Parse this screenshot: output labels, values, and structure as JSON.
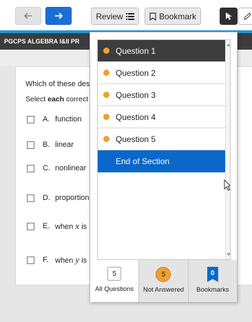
{
  "toolbar": {
    "back_icon": "arrow-left-icon",
    "next_icon": "arrow-right-icon",
    "review_label": "Review",
    "review_icon": "list-icon",
    "bookmark_label": "Bookmark",
    "bookmark_icon": "bookmark-icon",
    "pointer_icon": "pointer-icon",
    "pencil_icon": "pencil-icon",
    "accent_color": "#1a6fd6"
  },
  "section": {
    "title": "PGCPS ALGEBRA I&II PR"
  },
  "question": {
    "text": "Which of these des",
    "instruction_prefix": "Select ",
    "instruction_bold": "each",
    "instruction_suffix": " correct",
    "options": [
      {
        "letter": "A.",
        "text": "function"
      },
      {
        "letter": "B.",
        "text": "linear"
      },
      {
        "letter": "C.",
        "text": "nonlinear"
      },
      {
        "letter": "D.",
        "text": "proportion"
      },
      {
        "letter": "E.",
        "prefix": "when ",
        "var": "x",
        "suffix": " is"
      },
      {
        "letter": "F.",
        "prefix": "when ",
        "var": "y",
        "suffix": " is"
      }
    ]
  },
  "review_panel": {
    "items": [
      {
        "label": "Question 1",
        "status": "not-answered",
        "active": true
      },
      {
        "label": "Question 2",
        "status": "not-answered"
      },
      {
        "label": "Question 3",
        "status": "not-answered"
      },
      {
        "label": "Question 4",
        "status": "not-answered"
      },
      {
        "label": "Question 5",
        "status": "not-answered"
      }
    ],
    "end_label": "End of Section",
    "status_color": "#f0a030",
    "filters": {
      "all": {
        "count": "5",
        "label": "All Questions"
      },
      "not_answered": {
        "count": "5",
        "label": "Not Answered"
      },
      "bookmarks": {
        "count": "0",
        "label": "Bookmarks"
      }
    }
  }
}
